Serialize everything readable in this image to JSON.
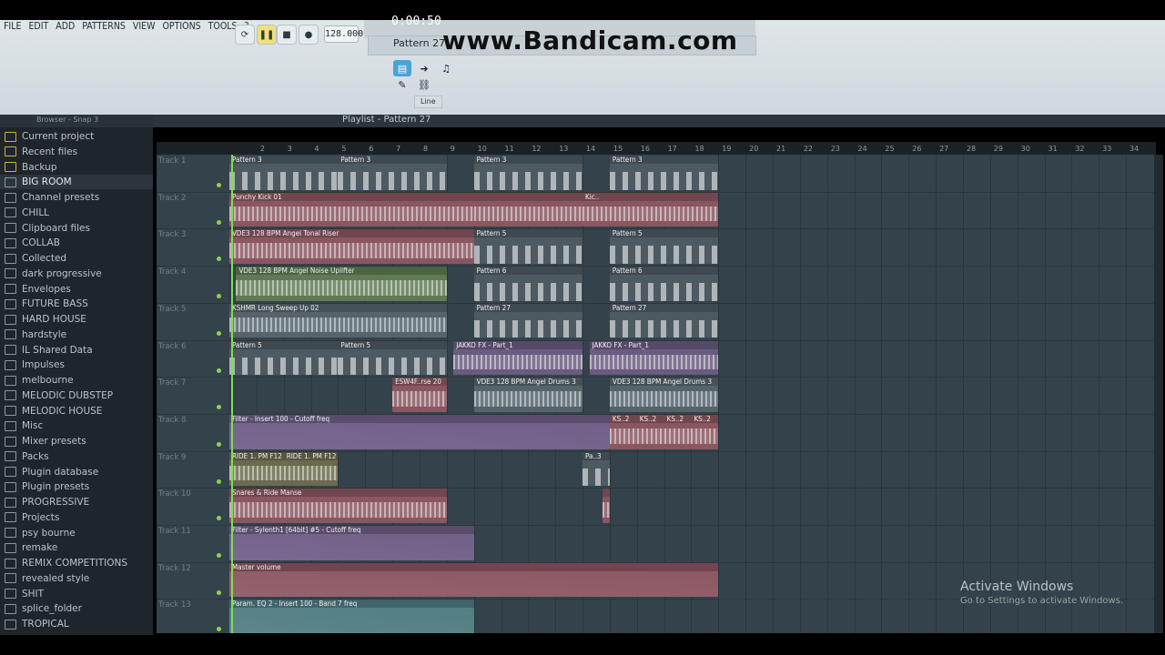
{
  "menu": [
    "FILE",
    "EDIT",
    "ADD",
    "PATTERNS",
    "VIEW",
    "OPTIONS",
    "TOOLS",
    "?"
  ],
  "transport": {
    "tempo": "128.000",
    "time": "0:00:50",
    "pattern": "Pattern 27",
    "snap_mode": "Line"
  },
  "watermark": "www.Bandicam.com",
  "browser": {
    "header": "Browser - Snap 3",
    "items": [
      "Current project",
      "Recent files",
      "Backup",
      "BIG ROOM",
      "Channel presets",
      "CHILL",
      "Clipboard files",
      "COLLAB",
      "Collected",
      "dark progressive",
      "Envelopes",
      "FUTURE BASS",
      "HARD HOUSE",
      "hardstyle",
      "IL Shared Data",
      "Impulses",
      "melbourne",
      "MELODIC DUBSTEP",
      "MELODIC HOUSE",
      "Misc",
      "Mixer presets",
      "Packs",
      "Plugin database",
      "Plugin presets",
      "PROGRESSIVE",
      "Projects",
      "psy bourne",
      "remake",
      "REMIX COMPETITIONS",
      "revealed style",
      "SHIT",
      "splice_folder",
      "TROPICAL"
    ]
  },
  "playlist": {
    "title": "Playlist - Pattern 27",
    "bars": [
      "2",
      "3",
      "4",
      "5",
      "6",
      "7",
      "8",
      "9",
      "10",
      "11",
      "12",
      "13",
      "14",
      "15",
      "16",
      "17",
      "18",
      "19",
      "20",
      "21",
      "22",
      "23",
      "24",
      "25",
      "26",
      "27",
      "28",
      "29",
      "30",
      "31",
      "32",
      "33",
      "34"
    ],
    "tracks": [
      "Track 1",
      "Track 2",
      "Track 3",
      "Track 4",
      "Track 5",
      "Track 6",
      "Track 7",
      "Track 8",
      "Track 9",
      "Track 10",
      "Track 11",
      "Track 12",
      "Track 13"
    ],
    "clips": [
      {
        "t": 0,
        "s": 1,
        "e": 5,
        "label": "Pattern 3",
        "kind": "pattern"
      },
      {
        "t": 0,
        "s": 5,
        "e": 9,
        "label": "Pattern 3",
        "kind": "pattern"
      },
      {
        "t": 0,
        "s": 10,
        "e": 14,
        "label": "Pattern 3",
        "kind": "pattern"
      },
      {
        "t": 0,
        "s": 15,
        "e": 19,
        "label": "Pattern 3",
        "kind": "pattern"
      },
      {
        "t": 1,
        "s": 1,
        "e": 10,
        "label": "Punchy Kick 01",
        "kind": "audio-red"
      },
      {
        "t": 1,
        "s": 10,
        "e": 14,
        "label": "",
        "kind": "audio-red"
      },
      {
        "t": 1,
        "s": 14,
        "e": 15,
        "label": "Kic..",
        "kind": "audio-red"
      },
      {
        "t": 1,
        "s": 15,
        "e": 19,
        "label": "",
        "kind": "audio-red"
      },
      {
        "t": 2,
        "s": 1,
        "e": 10,
        "label": "VDE3 128 BPM Angel Tonal Riser",
        "kind": "audio-red"
      },
      {
        "t": 2,
        "s": 10,
        "e": 14,
        "label": "Pattern 5",
        "kind": "pattern"
      },
      {
        "t": 2,
        "s": 15,
        "e": 19,
        "label": "Pattern 5",
        "kind": "pattern"
      },
      {
        "t": 3,
        "s": 1.25,
        "e": 9,
        "label": "VDE3 128 BPM Angel Noise Uplifter",
        "kind": "audio-green"
      },
      {
        "t": 3,
        "s": 10,
        "e": 14,
        "label": "Pattern 6",
        "kind": "pattern"
      },
      {
        "t": 3,
        "s": 15,
        "e": 19,
        "label": "Pattern 6",
        "kind": "pattern"
      },
      {
        "t": 4,
        "s": 1,
        "e": 9,
        "label": "KSHMR Long Sweep Up 02",
        "kind": "audio-slate"
      },
      {
        "t": 4,
        "s": 10,
        "e": 14,
        "label": "Pattern 27",
        "kind": "pattern"
      },
      {
        "t": 4,
        "s": 15,
        "e": 19,
        "label": "Pattern 27",
        "kind": "pattern"
      },
      {
        "t": 5,
        "s": 1,
        "e": 5,
        "label": "Pattern 5",
        "kind": "pattern"
      },
      {
        "t": 5,
        "s": 5,
        "e": 9,
        "label": "Pattern 5",
        "kind": "pattern"
      },
      {
        "t": 5,
        "s": 9.25,
        "e": 14,
        "label": "JAKKO FX - Part_1",
        "kind": "audio-purple"
      },
      {
        "t": 5,
        "s": 14.25,
        "e": 19,
        "label": "JAKKO FX - Part_1",
        "kind": "audio-purple"
      },
      {
        "t": 6,
        "s": 7,
        "e": 9,
        "label": "ESW4F..rse 20",
        "kind": "audio-red"
      },
      {
        "t": 6,
        "s": 10,
        "e": 14,
        "label": "VDE3 128 BPM Angel Drums 3",
        "kind": "audio-slate"
      },
      {
        "t": 6,
        "s": 15,
        "e": 19,
        "label": "VDE3 128 BPM Angel Drums 3",
        "kind": "audio-slate"
      },
      {
        "t": 7,
        "s": 1,
        "e": 15,
        "label": "Filter - Insert 100 - Cutoff freq",
        "kind": "auto-purple"
      },
      {
        "t": 7,
        "s": 15,
        "e": 16,
        "label": "KS..2",
        "kind": "audio-red"
      },
      {
        "t": 7,
        "s": 16,
        "e": 17,
        "label": "KS..2",
        "kind": "audio-red"
      },
      {
        "t": 7,
        "s": 17,
        "e": 18,
        "label": "KS..2",
        "kind": "audio-red"
      },
      {
        "t": 7,
        "s": 18,
        "e": 19,
        "label": "KS..2",
        "kind": "audio-red"
      },
      {
        "t": 8,
        "s": 1,
        "e": 3,
        "label": "RIDE 1. PM F12",
        "kind": "audio-olive"
      },
      {
        "t": 8,
        "s": 3,
        "e": 5,
        "label": "RIDE 1. PM F12",
        "kind": "audio-olive"
      },
      {
        "t": 8,
        "s": 14,
        "e": 15,
        "label": "Pa..3",
        "kind": "pattern"
      },
      {
        "t": 9,
        "s": 1,
        "e": 9,
        "label": "Snares & Ride Manse",
        "kind": "audio-red"
      },
      {
        "t": 9,
        "s": 14.75,
        "e": 15,
        "label": "",
        "kind": "audio-red"
      },
      {
        "t": 10,
        "s": 1,
        "e": 10,
        "label": "Filter - Sylenth1 [64bit] #5 - Cutoff freq",
        "kind": "auto-purple"
      },
      {
        "t": 11,
        "s": 1,
        "e": 19,
        "label": "Master volume",
        "kind": "auto-red"
      },
      {
        "t": 12,
        "s": 1,
        "e": 10,
        "label": "Param. EQ 2 - Insert 100 - Band 7 freq",
        "kind": "auto-teal"
      }
    ]
  },
  "os_overlay": {
    "title": "Activate Windows",
    "subtitle": "Go to Settings to activate Windows."
  },
  "colors": {
    "pattern": "#4d5a62",
    "audio-red": "#8a5660",
    "audio-green": "#5f7a54",
    "audio-slate": "#55636b",
    "audio-purple": "#6a5b80",
    "audio-olive": "#6b6a4e",
    "auto-purple": "#6e5d86",
    "auto-red": "#8b5560",
    "auto-teal": "#4f7c80"
  }
}
